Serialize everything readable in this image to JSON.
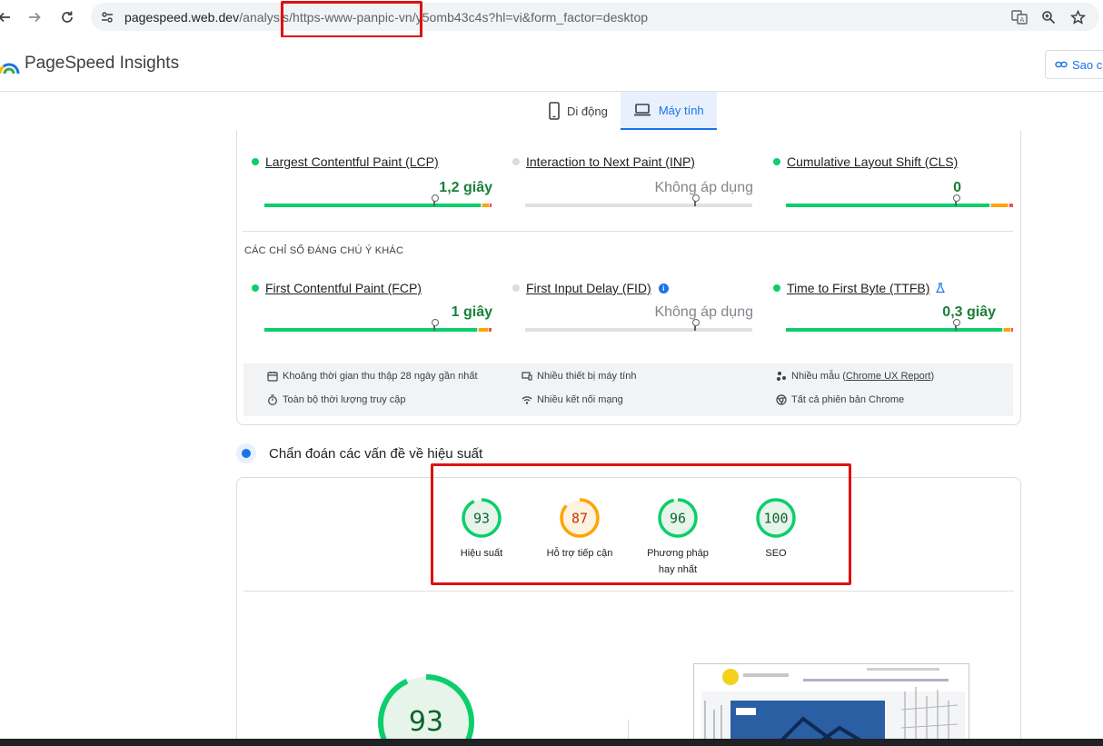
{
  "browser": {
    "url_host": "pagespeed.web.dev",
    "url_path": "/analysis/https-www-panpic-vn/y5omb43c4s?hl=vi&form_factor=desktop",
    "icons": [
      "back-arrow-icon",
      "forward-arrow-icon",
      "reload-icon",
      "site-info-icon",
      "translate-icon",
      "zoom-icon",
      "bookmark-star-icon"
    ]
  },
  "header": {
    "title": "PageSpeed Insights",
    "copy_button": "Sao ch"
  },
  "device_tabs": [
    {
      "label": "Di động",
      "active": false
    },
    {
      "label": "Máy tính",
      "active": true
    }
  ],
  "core_metrics": [
    {
      "label": "Largest Contentful Paint (LCP)",
      "value": "1,2 giây",
      "status": "good"
    },
    {
      "label": "Interaction to Next Paint (INP)",
      "value": "Không áp dụng",
      "status": "na"
    },
    {
      "label": "Cumulative Layout Shift (CLS)",
      "value": "0",
      "status": "good"
    }
  ],
  "other_section_label": "CÁC CHỈ SỐ ĐÁNG CHÚ Ý KHÁC",
  "other_metrics": [
    {
      "label": "First Contentful Paint (FCP)",
      "value": "1 giây",
      "status": "good"
    },
    {
      "label": "First Input Delay (FID)",
      "value": "Không áp dụng",
      "status": "na"
    },
    {
      "label": "Time to First Byte (TTFB)",
      "value": "0,3 giây",
      "status": "good"
    }
  ],
  "footer_info": {
    "collection_period": "Khoảng thời gian thu thập 28 ngày gần nhất",
    "devices": "Nhiều thiết bị máy tính",
    "samples_prefix": "Nhiều mẫu (",
    "samples_link": "Chrome UX Report",
    "samples_suffix": ")",
    "duration": "Toàn bộ thời lượng truy cập",
    "network": "Nhiều kết nối mạng",
    "chrome_versions": "Tất cả phiên bản Chrome"
  },
  "diagnose_title": "Chẩn đoán các vấn đề về hiệu suất",
  "scores": [
    {
      "value": "93",
      "label": "Hiệu suất",
      "color": "#0cce6b",
      "text_color": "#0d652d",
      "bg": "#e6f4ea"
    },
    {
      "value": "87",
      "label": "Hỗ trợ tiếp cận",
      "color": "#ffa400",
      "text_color": "#c33300",
      "bg": "#fff3e0"
    },
    {
      "value": "96",
      "label": "Phương pháp hay nhất",
      "color": "#0cce6b",
      "text_color": "#0d652d",
      "bg": "#e6f4ea"
    },
    {
      "value": "100",
      "label": "SEO",
      "color": "#0cce6b",
      "text_color": "#0d652d",
      "bg": "#e6f4ea"
    }
  ],
  "big_score": {
    "value": "93"
  },
  "colors": {
    "good": "#0cce6b",
    "average": "#ffa400",
    "poor": "#ff4e42",
    "accent": "#1a73e8",
    "annotation": "#e01010"
  }
}
